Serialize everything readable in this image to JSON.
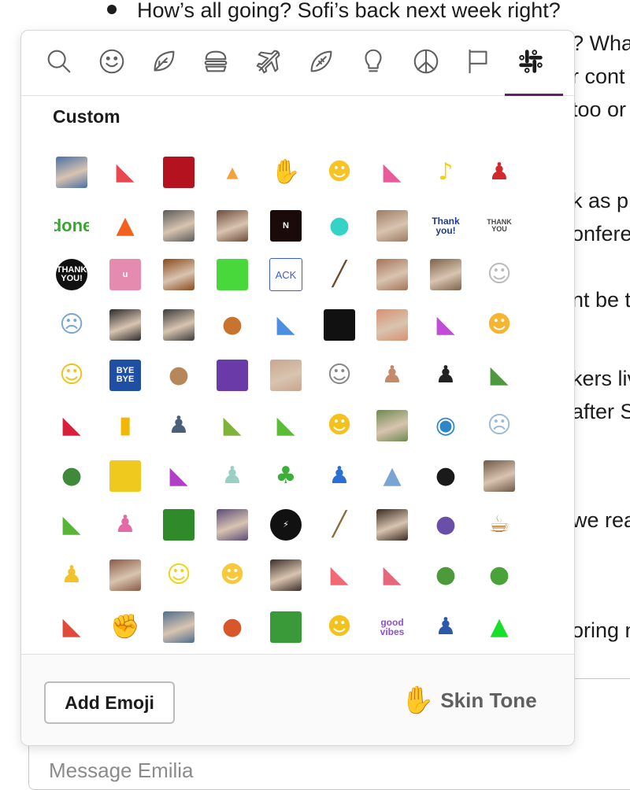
{
  "background": {
    "bullet_text": "How’s all going? Sofi’s back next week right?",
    "right_fragments": [
      "? Wha",
      "r cont",
      "too or",
      "k as p",
      "onfere",
      "nt be t",
      "kers liv",
      "after S",
      "we rea",
      "oring n"
    ],
    "composer_placeholder": "Message Emilia"
  },
  "picker": {
    "tabs": [
      {
        "name": "search-icon"
      },
      {
        "name": "smiley-icon"
      },
      {
        "name": "leaf-icon"
      },
      {
        "name": "burger-icon"
      },
      {
        "name": "airplane-icon"
      },
      {
        "name": "football-icon"
      },
      {
        "name": "lightbulb-icon"
      },
      {
        "name": "peace-icon"
      },
      {
        "name": "flag-icon"
      },
      {
        "name": "slack-icon"
      }
    ],
    "active_tab": "slack-icon",
    "accent_color": "#611f69",
    "section_title": "Custom",
    "emojis": [
      {
        "name": "portrait-photo-emoji",
        "kind": "photo",
        "color": "#4a6fa5"
      },
      {
        "name": "parrot-red-emoji",
        "kind": "glyph",
        "glyph": "◣",
        "color": "#e8494f"
      },
      {
        "name": "red-fez-emoji",
        "kind": "swatch",
        "color": "#b3121e"
      },
      {
        "name": "cake-emoji",
        "kind": "glyph",
        "glyph": "▴",
        "color": "#f4a23c"
      },
      {
        "name": "raised-hands-emoji",
        "kind": "glyph",
        "glyph": "✋",
        "color": "#e0b589"
      },
      {
        "name": "sad-smile-emoji",
        "kind": "glyph",
        "glyph": "☻",
        "color": "#f7c325"
      },
      {
        "name": "pink-parrot-emoji",
        "kind": "glyph",
        "glyph": "◣",
        "color": "#e85a9a"
      },
      {
        "name": "banana-dance-emoji",
        "kind": "glyph",
        "glyph": "♪",
        "color": "#f2d200"
      },
      {
        "name": "spiderman-emoji",
        "kind": "glyph",
        "glyph": "♟",
        "color": "#d12a2a"
      },
      {
        "name": "done-emoji",
        "kind": "text",
        "text": "done",
        "color": "#3aa532",
        "size": 22
      },
      {
        "name": "fire-emoji",
        "kind": "glyph",
        "glyph": "▲",
        "color": "#f2611e"
      },
      {
        "name": "person-photo-bw-emoji",
        "kind": "photo",
        "color": "#5a5a5a"
      },
      {
        "name": "person-photo-emoji",
        "kind": "photo",
        "color": "#6e4b3a"
      },
      {
        "name": "letter-n-fire-emoji",
        "kind": "swatch",
        "color": "#1a0a0a",
        "text": "N"
      },
      {
        "name": "ghost-cyan-emoji",
        "kind": "glyph",
        "glyph": "●",
        "color": "#34d3c6"
      },
      {
        "name": "woman-photo-emoji",
        "kind": "photo",
        "color": "#9d7b64"
      },
      {
        "name": "thank-you-text-emoji",
        "kind": "text",
        "text": "Thank you!",
        "color": "#1f3a93",
        "size": 12
      },
      {
        "name": "thank-you-sign-emoji",
        "kind": "text",
        "text": "THANK YOU",
        "color": "#444444",
        "size": 9
      },
      {
        "name": "thank-you-bubble-emoji",
        "kind": "swatch",
        "color": "#111111",
        "text": "THANK YOU!",
        "round": true
      },
      {
        "name": "letter-u-emoji",
        "kind": "swatch",
        "color": "#e58bb0",
        "text": "u"
      },
      {
        "name": "muppet-emoji",
        "kind": "photo",
        "color": "#8a4a1c"
      },
      {
        "name": "green-creature-emoji",
        "kind": "swatch",
        "color": "#48d83b"
      },
      {
        "name": "ack-emoji",
        "kind": "ack",
        "text": "ACK",
        "color": "#3b5bdb"
      },
      {
        "name": "rifle-emoji",
        "kind": "glyph",
        "glyph": "╱",
        "color": "#6b4a2c"
      },
      {
        "name": "woman-photo-2-emoji",
        "kind": "photo",
        "color": "#a6735a"
      },
      {
        "name": "man-photo-emoji",
        "kind": "photo",
        "color": "#7c6249"
      },
      {
        "name": "sketch-face-emoji",
        "kind": "glyph",
        "glyph": "☺",
        "color": "#bbbbbb"
      },
      {
        "name": "crying-cat-emoji",
        "kind": "glyph",
        "glyph": "☹",
        "color": "#7aa7d6"
      },
      {
        "name": "man-suit-emoji",
        "kind": "photo",
        "color": "#2b2b2b"
      },
      {
        "name": "batman-emoji",
        "kind": "photo",
        "color": "#3a3a3a"
      },
      {
        "name": "teddy-bear-emoji",
        "kind": "glyph",
        "glyph": "●",
        "color": "#c8742e"
      },
      {
        "name": "blue-parrot-emoji",
        "kind": "glyph",
        "glyph": "◣",
        "color": "#4c8fe0"
      },
      {
        "name": "black-square-emoji",
        "kind": "swatch",
        "color": "#111111"
      },
      {
        "name": "face-closeup-emoji",
        "kind": "photo",
        "color": "#d9906f"
      },
      {
        "name": "purple-parrot-emoji",
        "kind": "glyph",
        "glyph": "◣",
        "color": "#c24bd8"
      },
      {
        "name": "grimace-emoji",
        "kind": "glyph",
        "glyph": "☻",
        "color": "#f5b533"
      },
      {
        "name": "lightbulb-face-emoji",
        "kind": "glyph",
        "glyph": "☺",
        "color": "#f2c31c"
      },
      {
        "name": "bye-bye-emoji",
        "kind": "swatch",
        "color": "#1e4fa3",
        "text": "BYE BYE"
      },
      {
        "name": "capybara-emoji",
        "kind": "glyph",
        "glyph": "●",
        "color": "#b5875a"
      },
      {
        "name": "magic-carpet-emoji",
        "kind": "swatch",
        "color": "#6a3aa8"
      },
      {
        "name": "blurry-photo-emoji",
        "kind": "photo",
        "color": "#c9a58e"
      },
      {
        "name": "meme-face-emoji",
        "kind": "glyph",
        "glyph": "☺",
        "color": "#888888"
      },
      {
        "name": "dancing-man-emoji",
        "kind": "glyph",
        "glyph": "♟",
        "color": "#c48a6a"
      },
      {
        "name": "dancer-emoji",
        "kind": "glyph",
        "glyph": "♟",
        "color": "#222222"
      },
      {
        "name": "green-outline-parrot-emoji",
        "kind": "glyph",
        "glyph": "◣",
        "color": "#4d9a3d"
      },
      {
        "name": "christmas-parrot-emoji",
        "kind": "glyph",
        "glyph": "◣",
        "color": "#d81f3b"
      },
      {
        "name": "bars-emoji",
        "kind": "glyph",
        "glyph": "▮",
        "color": "#f2b705"
      },
      {
        "name": "desk-worker-emoji",
        "kind": "glyph",
        "glyph": "♟",
        "color": "#4a5f7a"
      },
      {
        "name": "confused-parrot-emoji",
        "kind": "glyph",
        "glyph": "◣",
        "color": "#7fb33c"
      },
      {
        "name": "green-parrot-emoji",
        "kind": "glyph",
        "glyph": "◣",
        "color": "#5bbd36"
      },
      {
        "name": "cool-crying-emoji",
        "kind": "glyph",
        "glyph": "☻",
        "color": "#f4c21f"
      },
      {
        "name": "woman-photo-3-emoji",
        "kind": "photo",
        "color": "#6c8a4d"
      },
      {
        "name": "globe-dance-emoji",
        "kind": "glyph",
        "glyph": "◉",
        "color": "#2e86c9"
      },
      {
        "name": "rage-face-emoji",
        "kind": "glyph",
        "glyph": "☹",
        "color": "#9bbbd8"
      },
      {
        "name": "frog-meme-emoji",
        "kind": "glyph",
        "glyph": "●",
        "color": "#3f8a3a"
      },
      {
        "name": "yellow-cube-emoji",
        "kind": "swatch",
        "color": "#f0c91e"
      },
      {
        "name": "dab-parrot-emoji",
        "kind": "glyph",
        "glyph": "◣",
        "color": "#b23fc7"
      },
      {
        "name": "dab-figure-emoji",
        "kind": "glyph",
        "glyph": "♟",
        "color": "#9ad0c4"
      },
      {
        "name": "cactus-emoji",
        "kind": "glyph",
        "glyph": "♣",
        "color": "#3dae3a"
      },
      {
        "name": "megaman-emoji",
        "kind": "glyph",
        "glyph": "♟",
        "color": "#2a6fd6"
      },
      {
        "name": "shark-emoji",
        "kind": "glyph",
        "glyph": "▲",
        "color": "#7aa5d2"
      },
      {
        "name": "penguin-emoji",
        "kind": "glyph",
        "glyph": "●",
        "color": "#1a1a1a"
      },
      {
        "name": "man-photo-2-emoji",
        "kind": "photo",
        "color": "#6e5848"
      },
      {
        "name": "sunglasses-parrot-emoji",
        "kind": "glyph",
        "glyph": "◣",
        "color": "#58b53a"
      },
      {
        "name": "pink-dance-emoji",
        "kind": "glyph",
        "glyph": "♟",
        "color": "#e36aa7"
      },
      {
        "name": "green-field-emoji",
        "kind": "swatch",
        "color": "#2f8a2a"
      },
      {
        "name": "news-desk-emoji",
        "kind": "photo",
        "color": "#5a4a78"
      },
      {
        "name": "lightning-bubble-emoji",
        "kind": "swatch",
        "color": "#111111",
        "text": "⚡",
        "round": true
      },
      {
        "name": "broom-emoji",
        "kind": "glyph",
        "glyph": "╱",
        "color": "#8a6a3b"
      },
      {
        "name": "man-photo-3-emoji",
        "kind": "photo",
        "color": "#3a2a20"
      },
      {
        "name": "purple-drop-emoji",
        "kind": "glyph",
        "glyph": "●",
        "color": "#6a4fa8"
      },
      {
        "name": "tea-cup-emoji",
        "kind": "glyph",
        "glyph": "☕",
        "color": "#c0772a"
      },
      {
        "name": "mr-burns-emoji",
        "kind": "glyph",
        "glyph": "♟",
        "color": "#f3c12a"
      },
      {
        "name": "laughing-man-emoji",
        "kind": "photo",
        "color": "#8a5a46"
      },
      {
        "name": "eyes-face-emoji",
        "kind": "glyph",
        "glyph": "☺",
        "color": "#f2d21a"
      },
      {
        "name": "thinking-face-emoji",
        "kind": "glyph",
        "glyph": "☻",
        "color": "#f6c83a"
      },
      {
        "name": "woman-dark-photo-emoji",
        "kind": "photo",
        "color": "#3d2e2a"
      },
      {
        "name": "pink-parrot-2-emoji",
        "kind": "glyph",
        "glyph": "◣",
        "color": "#ef6a73"
      },
      {
        "name": "fbi-parrot-emoji",
        "kind": "glyph",
        "glyph": "◣",
        "color": "#e7677a"
      },
      {
        "name": "pepe-emoji",
        "kind": "glyph",
        "glyph": "●",
        "color": "#4d9a3a"
      },
      {
        "name": "pepe-happy-emoji",
        "kind": "glyph",
        "glyph": "●",
        "color": "#49a23a"
      },
      {
        "name": "sombrero-parrot-emoji",
        "kind": "glyph",
        "glyph": "◣",
        "color": "#e04a3a"
      },
      {
        "name": "fist-bump-emoji",
        "kind": "glyph",
        "glyph": "✊",
        "color": "#f2cfa8"
      },
      {
        "name": "photo-strip-emoji",
        "kind": "photo",
        "color": "#4e6e8e"
      },
      {
        "name": "crab-emoji",
        "kind": "glyph",
        "glyph": "●",
        "color": "#d9552a"
      },
      {
        "name": "soccer-goal-emoji",
        "kind": "swatch",
        "color": "#3a9a3a"
      },
      {
        "name": "clapping-face-emoji",
        "kind": "glyph",
        "glyph": "☻",
        "color": "#f4c21c"
      },
      {
        "name": "good-vibes-emoji",
        "kind": "text",
        "text": "good vibes",
        "color": "#8b4fd6",
        "size": 12
      },
      {
        "name": "running-man-emoji",
        "kind": "glyph",
        "glyph": "♟",
        "color": "#2c5aa8"
      },
      {
        "name": "green-arrow-emoji",
        "kind": "glyph",
        "glyph": "▲",
        "color": "#18e02a"
      }
    ],
    "footer": {
      "add_emoji_label": "Add Emoji",
      "skin_tone_label": "Skin Tone",
      "skin_tone_icon": "raised-hand-icon"
    }
  }
}
